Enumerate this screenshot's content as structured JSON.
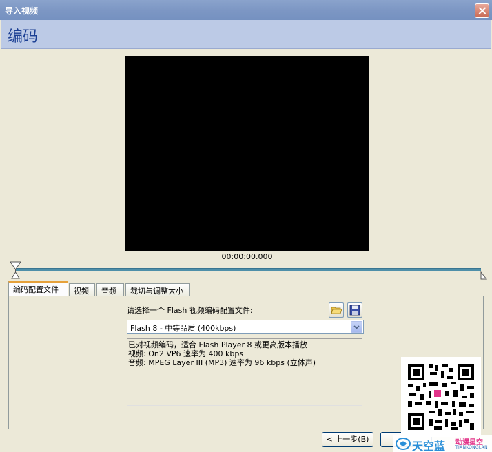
{
  "window": {
    "title": "导入视频"
  },
  "header": {
    "title": "编码"
  },
  "preview": {
    "timecode": "00:00:00.000"
  },
  "tabs": [
    {
      "label": "编码配置文件",
      "active": true
    },
    {
      "label": "视频",
      "active": false
    },
    {
      "label": "音频",
      "active": false
    },
    {
      "label": "裁切与调整大小",
      "active": false
    }
  ],
  "profile": {
    "prompt": "请选择一个 Flash 视频编码配置文件:",
    "selected": "Flash 8 - 中等品质 (400kbps)",
    "description": [
      "已对视频编码，适合 Flash Player 8 或更高版本播放",
      "视频: On2 VP6 速率为 400 kbps",
      "音频: MPEG Layer III (MP3) 速率为 96 kbps (立体声)"
    ]
  },
  "buttons": {
    "back": "< 上一步(B)"
  },
  "watermark": {
    "brand": "天空蓝",
    "tagline": "动漫星空",
    "sub": "TIANKONGLAN"
  },
  "colors": {
    "title_bar": "#7d97c4",
    "header_band": "#bccae6",
    "header_text": "#1b3f93",
    "scrubber": "#4e8fa9",
    "dialog_bg": "#ece9d8"
  }
}
